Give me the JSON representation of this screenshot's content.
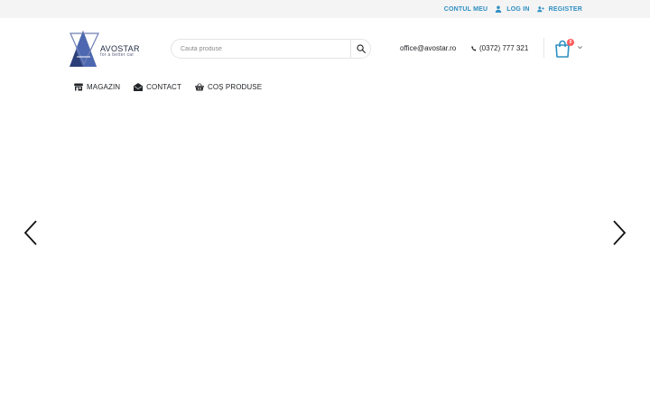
{
  "topbar": {
    "account_label": "CONTUL MEU",
    "login_label": "LOG IN",
    "register_label": "REGISTER"
  },
  "logo": {
    "brand": "AVOSTAR",
    "tagline": "for a better car"
  },
  "search": {
    "placeholder": "Cauta produse"
  },
  "contact": {
    "email": "office@avostar.ro",
    "phone": "(0372) 777 321"
  },
  "cart": {
    "count": "0"
  },
  "nav": {
    "items": [
      {
        "label": "MAGAZIN",
        "icon": "shop-icon"
      },
      {
        "label": "CONTACT",
        "icon": "envelope-open-icon"
      },
      {
        "label": "COȘ PRODUSE",
        "icon": "basket-icon"
      }
    ]
  },
  "colors": {
    "accent": "#2e8fc2",
    "badge": "#ff5b5b",
    "topbar_bg": "#f4f4f4",
    "text": "#222529"
  }
}
